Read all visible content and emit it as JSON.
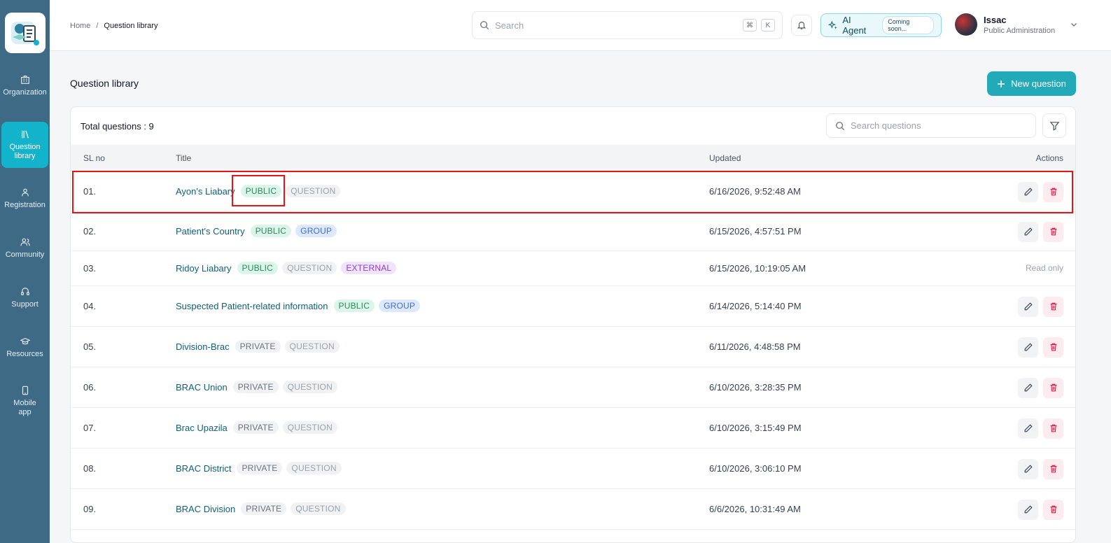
{
  "sidebar": {
    "items": [
      {
        "label": "Organization",
        "icon": "building-icon"
      },
      {
        "label": "Question library",
        "icon": "library-icon"
      },
      {
        "label": "Registration",
        "icon": "registration-icon"
      },
      {
        "label": "Community",
        "icon": "users-icon"
      },
      {
        "label": "Support",
        "icon": "headset-icon"
      },
      {
        "label": "Resources",
        "icon": "graduation-cap-icon"
      },
      {
        "label": "Mobile app",
        "icon": "smartphone-icon"
      }
    ]
  },
  "header": {
    "breadcrumb": {
      "home": "Home",
      "separator": "/",
      "current": "Question library"
    },
    "search_placeholder": "Search",
    "kbd": [
      "⌘",
      "K"
    ],
    "ai_agent_label": "AI Agent",
    "ai_agent_badge": "Coming soon...",
    "user": {
      "name": "Issac",
      "role": "Public Administration"
    }
  },
  "main": {
    "title": "Question library",
    "new_button": "New question",
    "total_label": "Total questions : 9",
    "search_placeholder": "Search questions",
    "columns": {
      "sl": "SL no",
      "title": "Title",
      "updated": "Updated",
      "actions": "Actions"
    },
    "rows": [
      {
        "sl": "01.",
        "title": "Ayon's Liabary",
        "tags": [
          "PUBLIC",
          "QUESTION"
        ],
        "updated": "6/16/2026, 9:52:48 AM",
        "readonly": ""
      },
      {
        "sl": "02.",
        "title": "Patient's Country",
        "tags": [
          "PUBLIC",
          "GROUP"
        ],
        "updated": "6/15/2026, 4:57:51 PM",
        "readonly": ""
      },
      {
        "sl": "03.",
        "title": "Ridoy Liabary",
        "tags": [
          "PUBLIC",
          "QUESTION",
          "EXTERNAL"
        ],
        "updated": "6/15/2026, 10:19:05 AM",
        "readonly": "Read only"
      },
      {
        "sl": "04.",
        "title": "Suspected Patient-related information",
        "tags": [
          "PUBLIC",
          "GROUP"
        ],
        "updated": "6/14/2026, 5:14:40 PM",
        "readonly": ""
      },
      {
        "sl": "05.",
        "title": "Division-Brac",
        "tags": [
          "PRIVATE",
          "QUESTION"
        ],
        "updated": "6/11/2026, 4:48:58 PM",
        "readonly": ""
      },
      {
        "sl": "06.",
        "title": "BRAC Union",
        "tags": [
          "PRIVATE",
          "QUESTION"
        ],
        "updated": "6/10/2026, 3:28:35 PM",
        "readonly": ""
      },
      {
        "sl": "07.",
        "title": "Brac Upazila",
        "tags": [
          "PRIVATE",
          "QUESTION"
        ],
        "updated": "6/10/2026, 3:15:49 PM",
        "readonly": ""
      },
      {
        "sl": "08.",
        "title": "BRAC District",
        "tags": [
          "PRIVATE",
          "QUESTION"
        ],
        "updated": "6/10/2026, 3:06:10 PM",
        "readonly": ""
      },
      {
        "sl": "09.",
        "title": "BRAC Division",
        "tags": [
          "PRIVATE",
          "QUESTION"
        ],
        "updated": "6/6/2026, 10:31:49 AM",
        "readonly": ""
      }
    ]
  },
  "colors": {
    "sidebar": "#3f6a86",
    "accent": "#14b3cc",
    "primary_button": "#22aab8",
    "highlight": "#ee1111"
  }
}
